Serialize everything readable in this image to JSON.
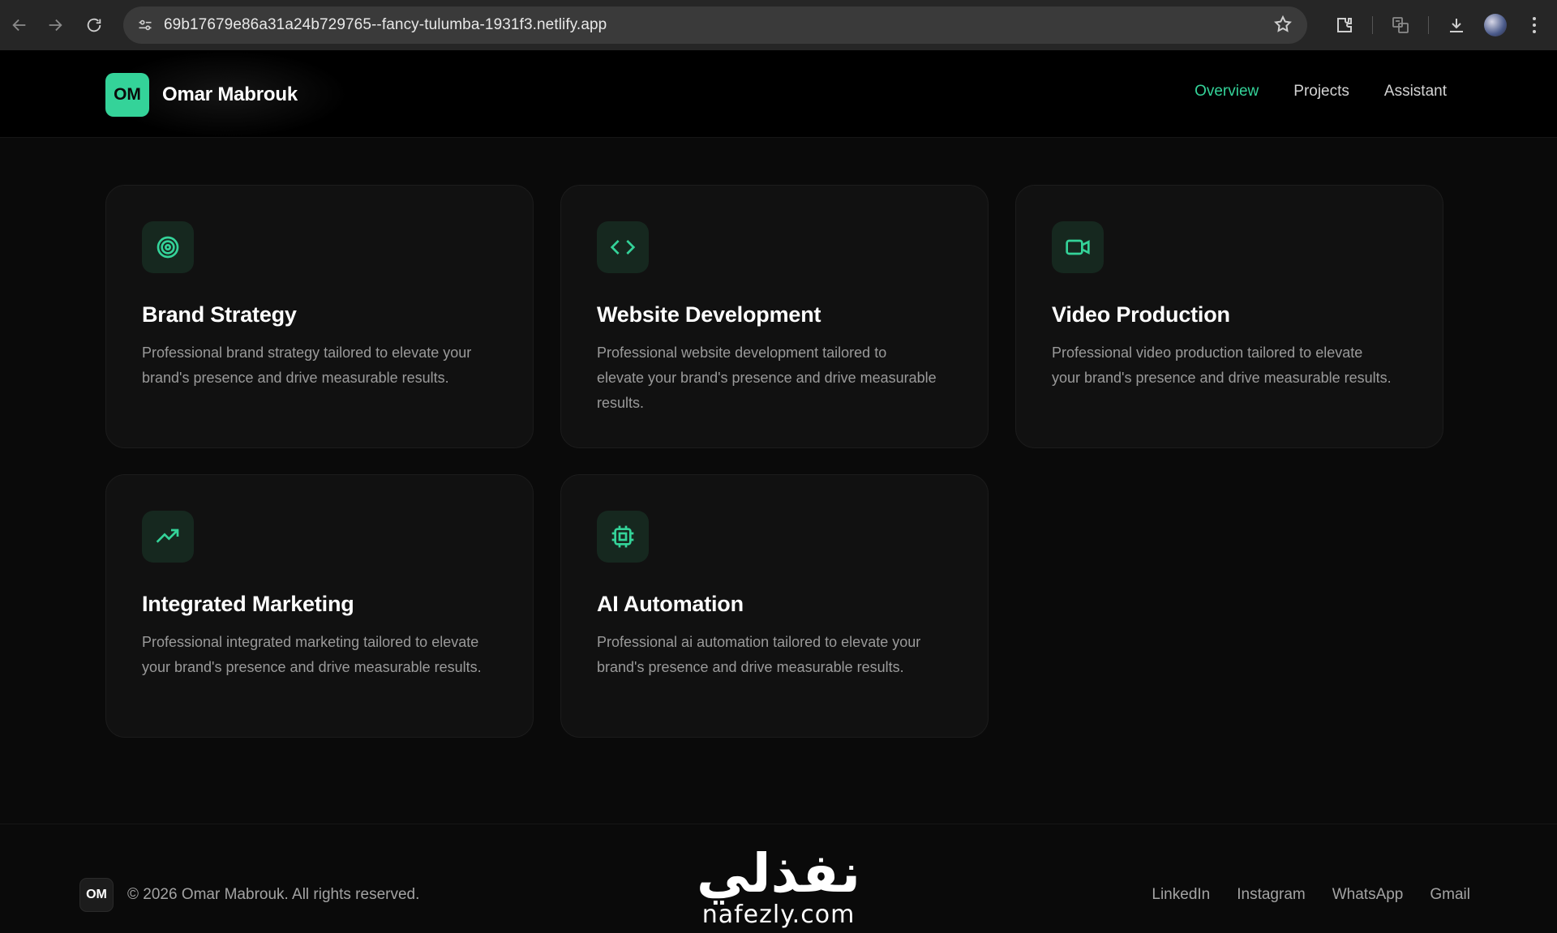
{
  "browser": {
    "url": "69b17679e86a31a24b729765--fancy-tulumba-1931f3.netlify.app"
  },
  "header": {
    "logo_initials": "OM",
    "brand_name": "Omar Mabrouk",
    "nav": [
      {
        "label": "Overview",
        "active": true
      },
      {
        "label": "Projects",
        "active": false
      },
      {
        "label": "Assistant",
        "active": false
      }
    ]
  },
  "services": [
    {
      "icon": "target-icon",
      "title": "Brand Strategy",
      "description": "Professional brand strategy tailored to elevate your brand's presence and drive measurable results."
    },
    {
      "icon": "code-icon",
      "title": "Website Development",
      "description": "Professional website development tailored to elevate your brand's presence and drive measurable results."
    },
    {
      "icon": "video-camera-icon",
      "title": "Video Production",
      "description": "Professional video production tailored to elevate your brand's presence and drive measurable results."
    },
    {
      "icon": "trending-up-icon",
      "title": "Integrated Marketing",
      "description": "Professional integrated marketing tailored to elevate your brand's presence and drive measurable results."
    },
    {
      "icon": "cpu-chip-icon",
      "title": "AI Automation",
      "description": "Professional ai automation tailored to elevate your brand's presence and drive measurable results."
    }
  ],
  "footer": {
    "logo_initials": "OM",
    "copyright": "© 2026 Omar Mabrouk. All rights reserved.",
    "links": [
      "LinkedIn",
      "Instagram",
      "WhatsApp",
      "Gmail"
    ]
  },
  "watermark": {
    "arabic": "نفذلي",
    "latin": "nafezly.com"
  },
  "colors": {
    "accent": "#34d399",
    "background": "#0a0a0a",
    "card": "#111111"
  }
}
